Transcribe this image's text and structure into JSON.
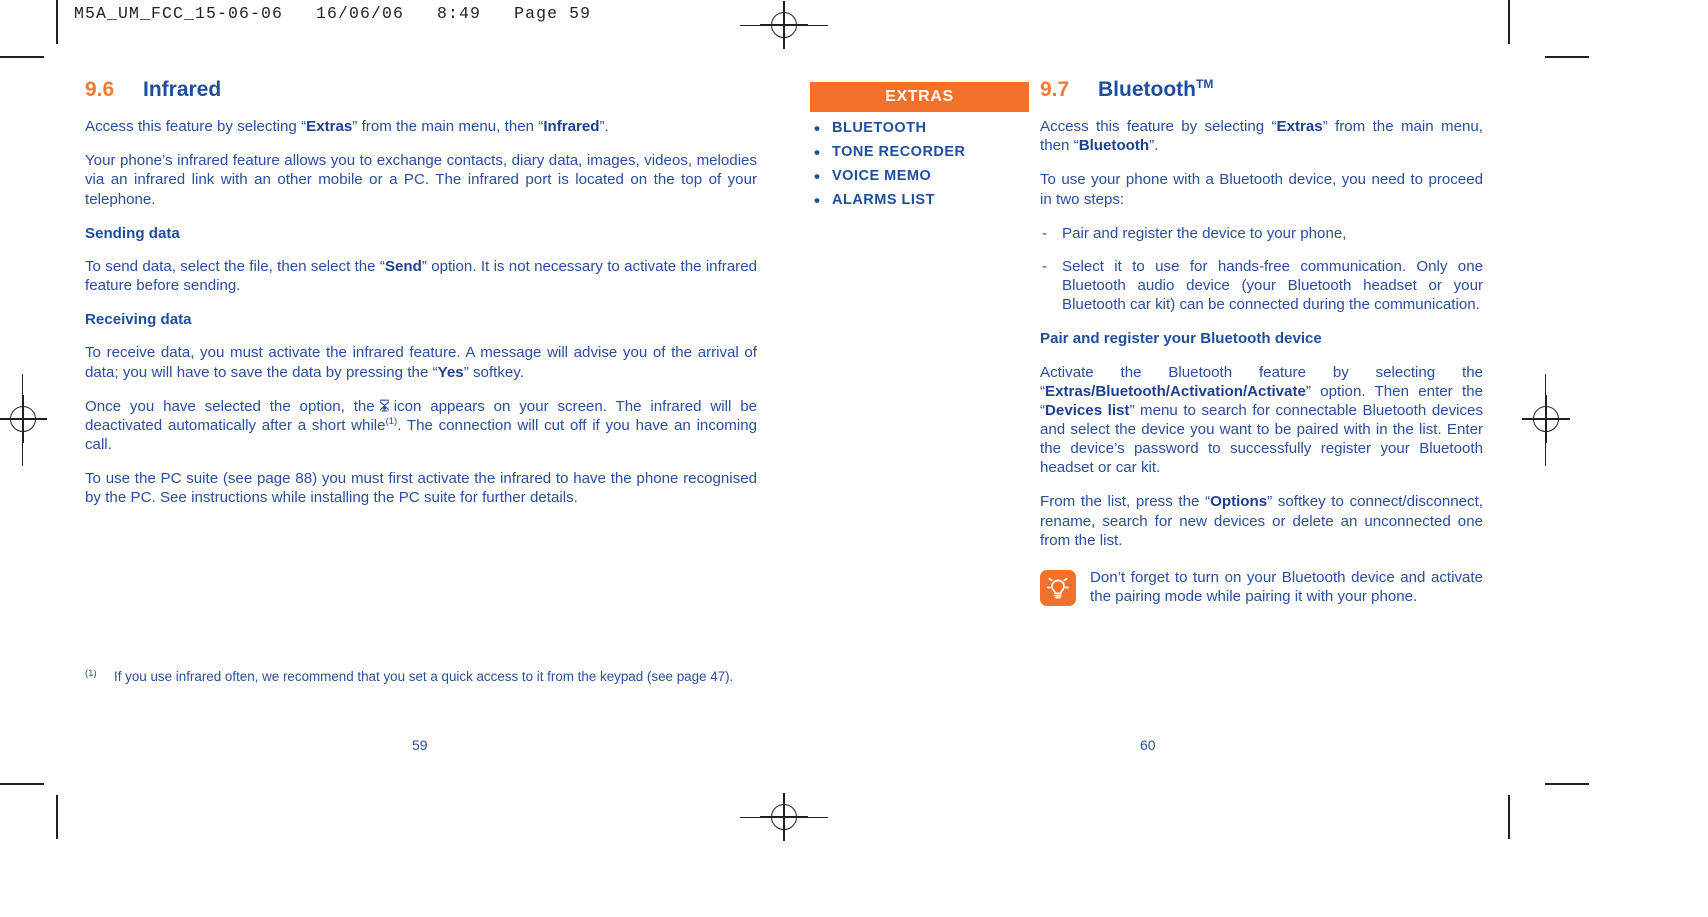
{
  "prepress": {
    "header": "M5A_UM_FCC_15-06-06   16/06/06   8:49   Page 59"
  },
  "left_page": {
    "folio": "59",
    "section": {
      "number": "9.6",
      "title": "Infrared"
    },
    "p1_a": "Access this feature by selecting “",
    "p1_b": "Extras",
    "p1_c": "” from the main menu, then “",
    "p1_d": "Infrared",
    "p1_e": "”.",
    "p2": "Your phone’s infrared feature allows you to exchange contacts, diary data, images, videos, melodies via an infrared link with an other mobile or a PC. The infrared port is located on the top of your telephone.",
    "h_sending": "Sending data",
    "p3_a": "To send data, select the file, then select the “",
    "p3_b": "Send",
    "p3_c": "” option. It is not necessary to activate the infrared feature before sending.",
    "h_receiving": "Receiving data",
    "p4_a": "To receive data, you must activate the infrared feature. A message will advise you of the arrival of data; you will have to save the data by pressing the “",
    "p4_b": "Yes",
    "p4_c": "” softkey.",
    "p5_a": "Once you have selected the option, the",
    "p5_b": "icon appears on your screen. The infrared will be deactivated automatically after a short while",
    "p5_marker": "(1)",
    "p5_c": ". The connection will cut off if you have an incoming call.",
    "p6": "To use the PC suite (see page 88) you must first activate the infrared to have the phone recognised by the PC. See instructions while installing the PC suite for further details.",
    "footnote": {
      "marker": "(1)",
      "text": "If you use infrared often, we recommend that you set a quick access to it from the keypad (see page 47)."
    }
  },
  "extras_panel": {
    "title": "EXTRAS",
    "items": [
      "BLUETOOTH",
      "TONE RECORDER",
      "VOICE MEMO",
      "ALARMS LIST"
    ]
  },
  "right_page": {
    "folio": "60",
    "section": {
      "number": "9.7",
      "title": "Bluetooth",
      "trademark": "TM"
    },
    "p1_a": "Access this feature by selecting “",
    "p1_b": "Extras",
    "p1_c": "” from the main menu, then “",
    "p1_d": "Bluetooth",
    "p1_e": "”.",
    "p2": "To use your phone with a Bluetooth device, you need to proceed in two steps:",
    "bullets": [
      "Pair and register the device to your phone,",
      "Select it to use for hands-free communication. Only one Bluetooth audio device (your Bluetooth headset or your Bluetooth car kit) can be connected during the communication."
    ],
    "h_pair": "Pair and register your Bluetooth device",
    "p3_a": "Activate the Bluetooth feature by selecting the “",
    "p3_b": "Extras/Bluetooth/Activation/Activate",
    "p3_c": "” option. Then enter the “",
    "p3_d": "Devices list",
    "p3_e": "” menu to search for connectable Bluetooth devices and select the device you want to be paired with in the list. Enter the device’s password to successfully register your Bluetooth headset or car kit.",
    "p4_a": "From the list, press the “",
    "p4_b": "Options",
    "p4_c": "” softkey to connect/disconnect, rename, search for new devices or delete an unconnected one from the list.",
    "note": {
      "icon": "lightbulb-tip-icon",
      "text": "Don’t forget to turn on your Bluetooth device and activate the pairing mode while pairing it with your phone."
    }
  },
  "colors": {
    "orange": "#f2722b",
    "blue_heading": "#1f4e9c",
    "blue_body": "#2b4d9b",
    "crop_mark": "#231f20"
  }
}
